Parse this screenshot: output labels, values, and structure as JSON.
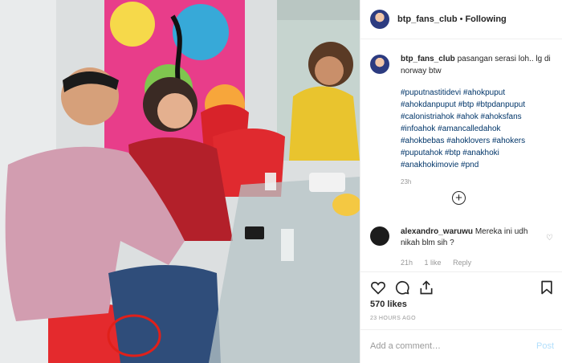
{
  "header": {
    "username": "btp_fans_club",
    "separator": "•",
    "follow_label": "Following"
  },
  "caption": {
    "username": "btp_fans_club",
    "text": "pasangan serasi loh.. lg di norway btw",
    "hashtags": [
      "#puputnastitidevi #ahokpuput",
      "#ahokdanpuput #btp #btpdanpuput",
      "#calonistriahok #ahok #ahoksfans",
      "#infoahok #amancalledahok",
      "#ahokbebas #ahoklovers #ahokers",
      "#puputahok #btp #anakhoki",
      "#anakhokimovie #pnd"
    ],
    "time": "23h"
  },
  "load_more_icon": "plus-circle-icon",
  "comment": {
    "username": "alexandro_waruwu",
    "text": "Mereka ini udh nikah blm sih ?",
    "time": "21h",
    "likes": "1 like",
    "reply": "Reply"
  },
  "actions": {
    "icons": [
      "heart-icon",
      "comment-icon",
      "share-icon",
      "bookmark-icon"
    ]
  },
  "likes_count": "570 likes",
  "posted_ago": "23 HOURS AGO",
  "add_comment": {
    "placeholder": "Add a comment…",
    "post_label": "Post"
  },
  "colors": {
    "hashtag": "#003569",
    "post_disabled": "#b2dffc",
    "highlight_circle": "#e0201a"
  }
}
